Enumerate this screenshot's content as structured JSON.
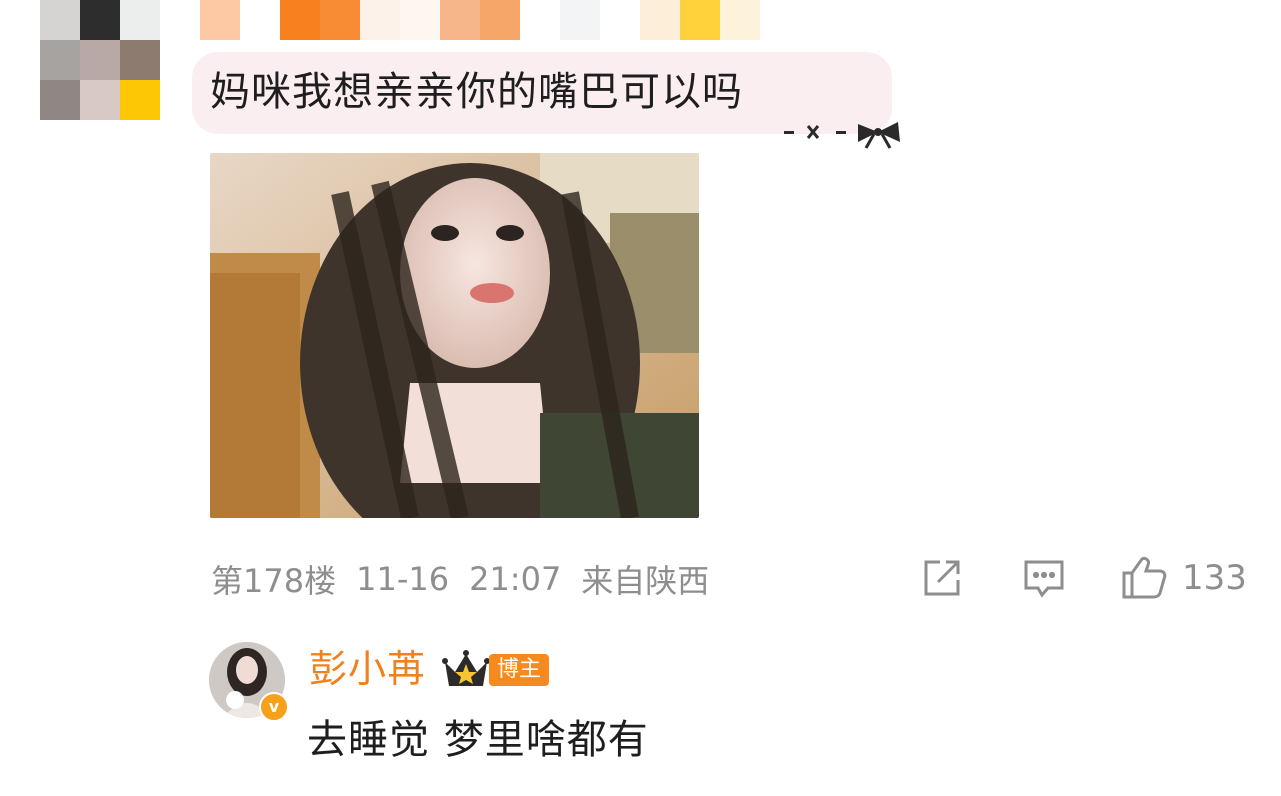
{
  "comment": {
    "text": "妈咪我想亲亲你的嘴巴可以吗",
    "floor": "第178楼",
    "date": "11-16",
    "time": "21:07",
    "location": "来自陕西",
    "like_count": "133"
  },
  "reply": {
    "author": "彭小苒",
    "author_badge": "博主",
    "verified_mark": "v",
    "text": "去睡觉 梦里啥都有"
  },
  "colors": {
    "bubble_bg": "#fbeef1",
    "meta_gray": "#8e8e8e",
    "author_orange": "#f0821d",
    "badge_orange": "#f68a1f"
  },
  "icons": [
    "share-icon",
    "comment-icon",
    "like-icon",
    "bow-icon",
    "crown-icon"
  ]
}
